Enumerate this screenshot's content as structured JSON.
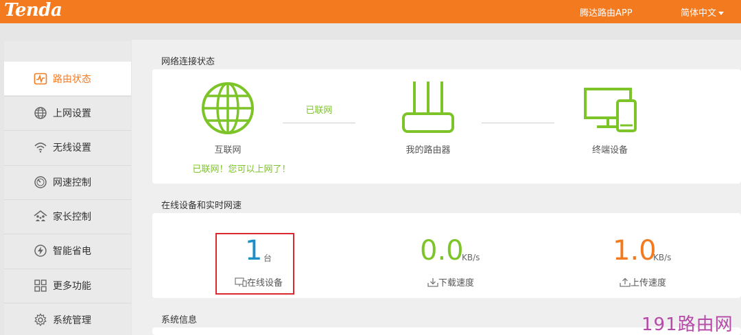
{
  "header": {
    "logo": "Tenda",
    "app_link": "腾达路由APP",
    "language": "简体中文"
  },
  "sidebar": {
    "items": [
      {
        "label": "路由状态",
        "icon": "status-chart-icon",
        "active": true
      },
      {
        "label": "上网设置",
        "icon": "globe-icon",
        "active": false
      },
      {
        "label": "无线设置",
        "icon": "wifi-icon",
        "active": false
      },
      {
        "label": "网速控制",
        "icon": "gauge-icon",
        "active": false
      },
      {
        "label": "家长控制",
        "icon": "family-icon",
        "active": false
      },
      {
        "label": "智能省电",
        "icon": "power-save-icon",
        "active": false
      },
      {
        "label": "更多功能",
        "icon": "grid-icon",
        "active": false
      },
      {
        "label": "系统管理",
        "icon": "gear-icon",
        "active": false
      }
    ]
  },
  "network_status": {
    "title": "网络连接状态",
    "internet_label": "互联网",
    "connection_state": "已联网",
    "connection_message": "已联网！您可以上网了！",
    "router_label": "我的路由器",
    "devices_label": "终端设备"
  },
  "online": {
    "title": "在线设备和实时网速",
    "device_count": "1",
    "device_unit": "台",
    "device_label": "在线设备",
    "download_value": "0.0",
    "download_unit": "KB/s",
    "download_label": "下载速度",
    "upload_value": "1.0",
    "upload_unit": "KB/s",
    "upload_label": "上传速度"
  },
  "system": {
    "title": "系统信息"
  },
  "watermark": "191路由网",
  "colors": {
    "brand_orange": "#f47a20",
    "status_green": "#7cc427",
    "count_blue": "#1d8fc6",
    "upload_orange": "#f47a20",
    "highlight_red": "#d9282e"
  }
}
